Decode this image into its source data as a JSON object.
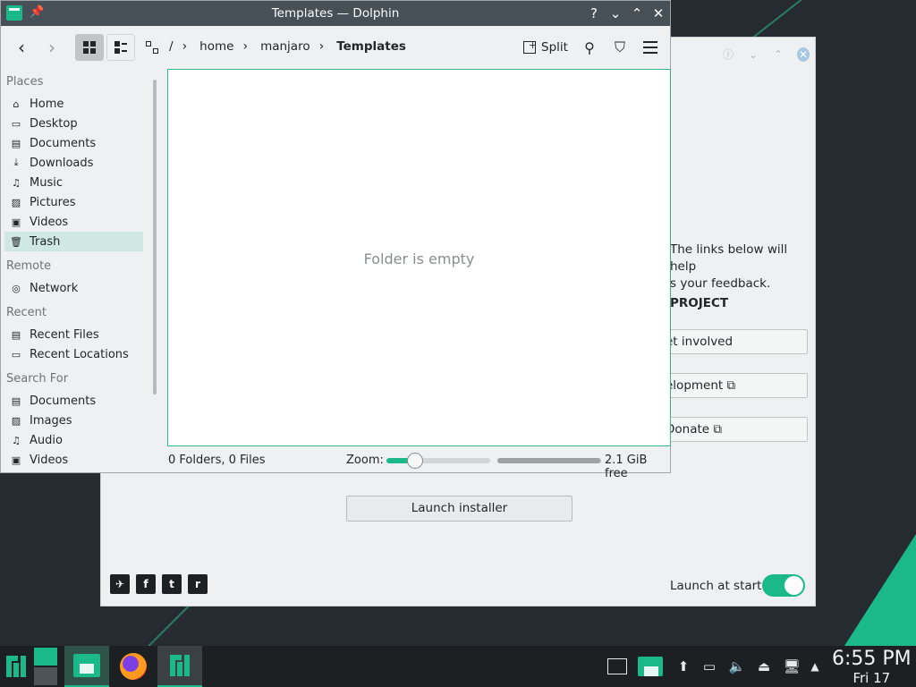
{
  "dolphin": {
    "title": "Templates — Dolphin",
    "title_controls": [
      "?",
      "⌄",
      "⌃",
      "✕"
    ],
    "toolbar": {
      "back": "‹",
      "forward": "›",
      "split_label": "Split"
    },
    "breadcrumb": {
      "root": "/",
      "parts": [
        "home",
        "manjaro",
        "Templates"
      ]
    },
    "places": {
      "sections": [
        {
          "header": "Places",
          "items": [
            {
              "label": "Home",
              "icon": "home-icon"
            },
            {
              "label": "Desktop",
              "icon": "desktop-icon"
            },
            {
              "label": "Documents",
              "icon": "documents-icon"
            },
            {
              "label": "Downloads",
              "icon": "downloads-icon"
            },
            {
              "label": "Music",
              "icon": "music-icon"
            },
            {
              "label": "Pictures",
              "icon": "pictures-icon"
            },
            {
              "label": "Videos",
              "icon": "videos-icon"
            },
            {
              "label": "Trash",
              "icon": "trash-icon",
              "selected": true
            }
          ]
        },
        {
          "header": "Remote",
          "items": [
            {
              "label": "Network",
              "icon": "network-icon"
            }
          ]
        },
        {
          "header": "Recent",
          "items": [
            {
              "label": "Recent Files",
              "icon": "recent-files-icon"
            },
            {
              "label": "Recent Locations",
              "icon": "recent-locations-icon"
            }
          ]
        },
        {
          "header": "Search For",
          "items": [
            {
              "label": "Documents",
              "icon": "documents-icon"
            },
            {
              "label": "Images",
              "icon": "images-icon"
            },
            {
              "label": "Audio",
              "icon": "audio-icon"
            },
            {
              "label": "Videos",
              "icon": "videos-icon"
            }
          ]
        }
      ]
    },
    "view": {
      "empty_text": "Folder is empty"
    },
    "status": {
      "count": "0 Folders, 0 Files",
      "zoom_label": "Zoom:",
      "zoom_fraction": 0.28,
      "space_used_fraction": 0.99,
      "free_space": "2.1 GiB free"
    }
  },
  "welcome": {
    "text_line1": "The links below will help",
    "text_line2": "s your feedback.",
    "project_heading": "PROJECT",
    "buttons": [
      "et involved",
      "elopment ⧉",
      "Donate ⧉"
    ],
    "launch_installer": "Launch installer",
    "social": [
      "✈",
      "f",
      "t",
      "r"
    ],
    "launch_at_start": "Launch at start",
    "launch_at_start_on": true
  },
  "taskbar": {
    "time": "6:55 PM",
    "date": "Fri 17"
  },
  "colors": {
    "accent": "#1bb88a",
    "titlebar": "#475057",
    "taskbar": "#1d2023"
  }
}
